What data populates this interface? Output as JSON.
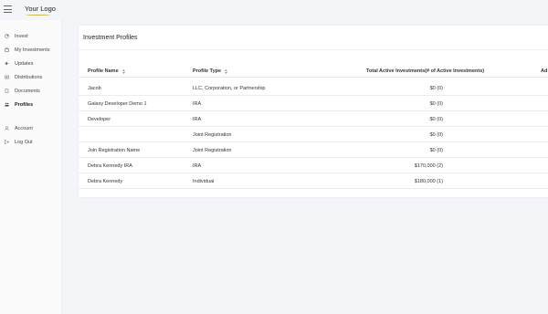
{
  "brand": {
    "logo": "Your Logo"
  },
  "sidebar": {
    "items": [
      {
        "label": "Invest",
        "icon": "chart-icon"
      },
      {
        "label": "My Investments",
        "icon": "briefcase-icon"
      },
      {
        "label": "Updates",
        "icon": "megaphone-icon"
      },
      {
        "label": "Distributions",
        "icon": "money-icon"
      },
      {
        "label": "Documents",
        "icon": "document-icon"
      },
      {
        "label": "Profiles",
        "icon": "profile-icon",
        "active": true
      },
      {
        "label": "Account",
        "icon": "user-icon"
      },
      {
        "label": "Log Out",
        "icon": "logout-icon"
      }
    ]
  },
  "page": {
    "title": "Investment Profiles"
  },
  "table": {
    "headers": {
      "name": "Profile Name",
      "type": "Profile Type",
      "total": "Total Active Investments(# of Active Investments)",
      "cut": "Ad"
    },
    "rows": [
      {
        "name": "Jacob",
        "type": "LLC, Corporation, or Partnership",
        "total": "$0 (0)"
      },
      {
        "name": "Galaxy Developer Demo 1",
        "type": "IRA",
        "total": "$0 (0)"
      },
      {
        "name": "Developer",
        "type": "IRA",
        "total": "$0 (0)"
      },
      {
        "name": "",
        "type": "Joint Registration",
        "total": "$0 (0)"
      },
      {
        "name": "Join Registration Name",
        "type": "Joint Registration",
        "total": "$0 (0)"
      },
      {
        "name": "Debra Kennedy IRA",
        "type": "IRA",
        "total": "$170,000 (2)"
      },
      {
        "name": "Debra Kennedy",
        "type": "Individual",
        "total": "$180,000 (1)"
      }
    ]
  }
}
